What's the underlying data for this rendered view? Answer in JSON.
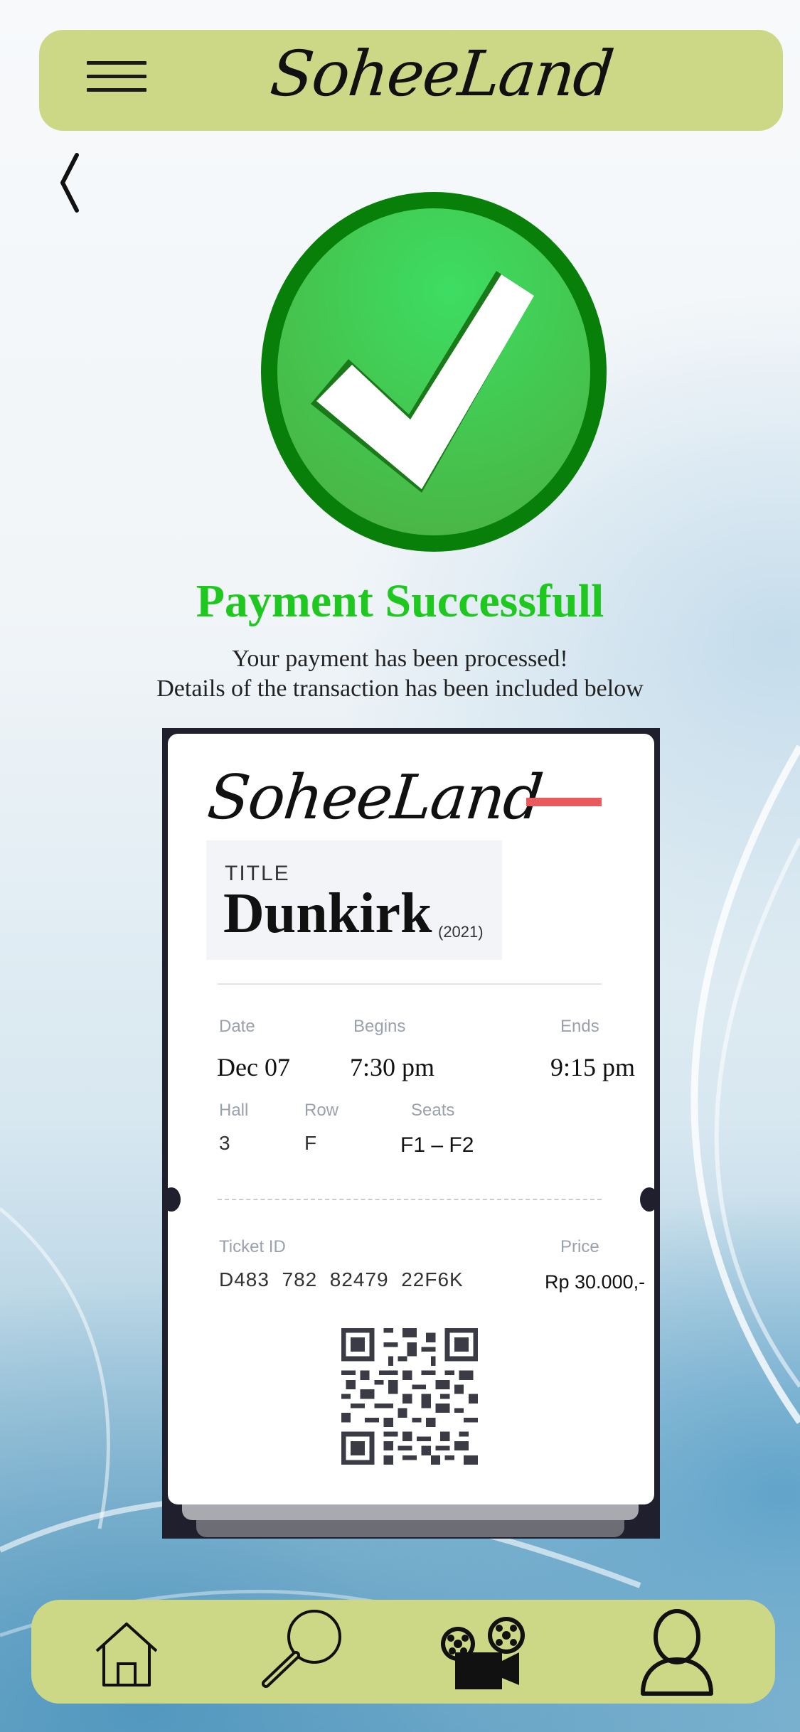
{
  "header": {
    "brand": "SoheeLand",
    "menu_icon": "hamburger-menu-icon"
  },
  "nav_back_icon": "chevron-left-icon",
  "status": {
    "icon": "checkmark-icon",
    "title": "Payment Successfull",
    "line1": "Your payment has been processed!",
    "line2": "Details of the transaction has been included below"
  },
  "ticket": {
    "brand": "SoheeLand",
    "title_label": "TITLE",
    "movie": "Dunkirk",
    "year": "(2021)",
    "date_label": "Date",
    "date": "Dec 07",
    "begins_label": "Begins",
    "begins": "7:30 pm",
    "ends_label": "Ends",
    "ends": "9:15 pm",
    "hall_label": "Hall",
    "hall": "3",
    "row_label": "Row",
    "row": "F",
    "seats_label": "Seats",
    "seats": "F1 – F2",
    "ticket_id_label": "Ticket ID",
    "ticket_id": "D483  782  82479  22F6K",
    "price_label": "Price",
    "price": "Rp 30.000,-"
  },
  "bottom_nav": [
    "home-icon",
    "search-icon",
    "movie-projector-icon",
    "profile-icon"
  ],
  "colors": {
    "bar": "#cdd886",
    "success_green": "#1fc81f",
    "accent_red": "#e85a5e",
    "ticket_frame": "#1f1f2e"
  }
}
